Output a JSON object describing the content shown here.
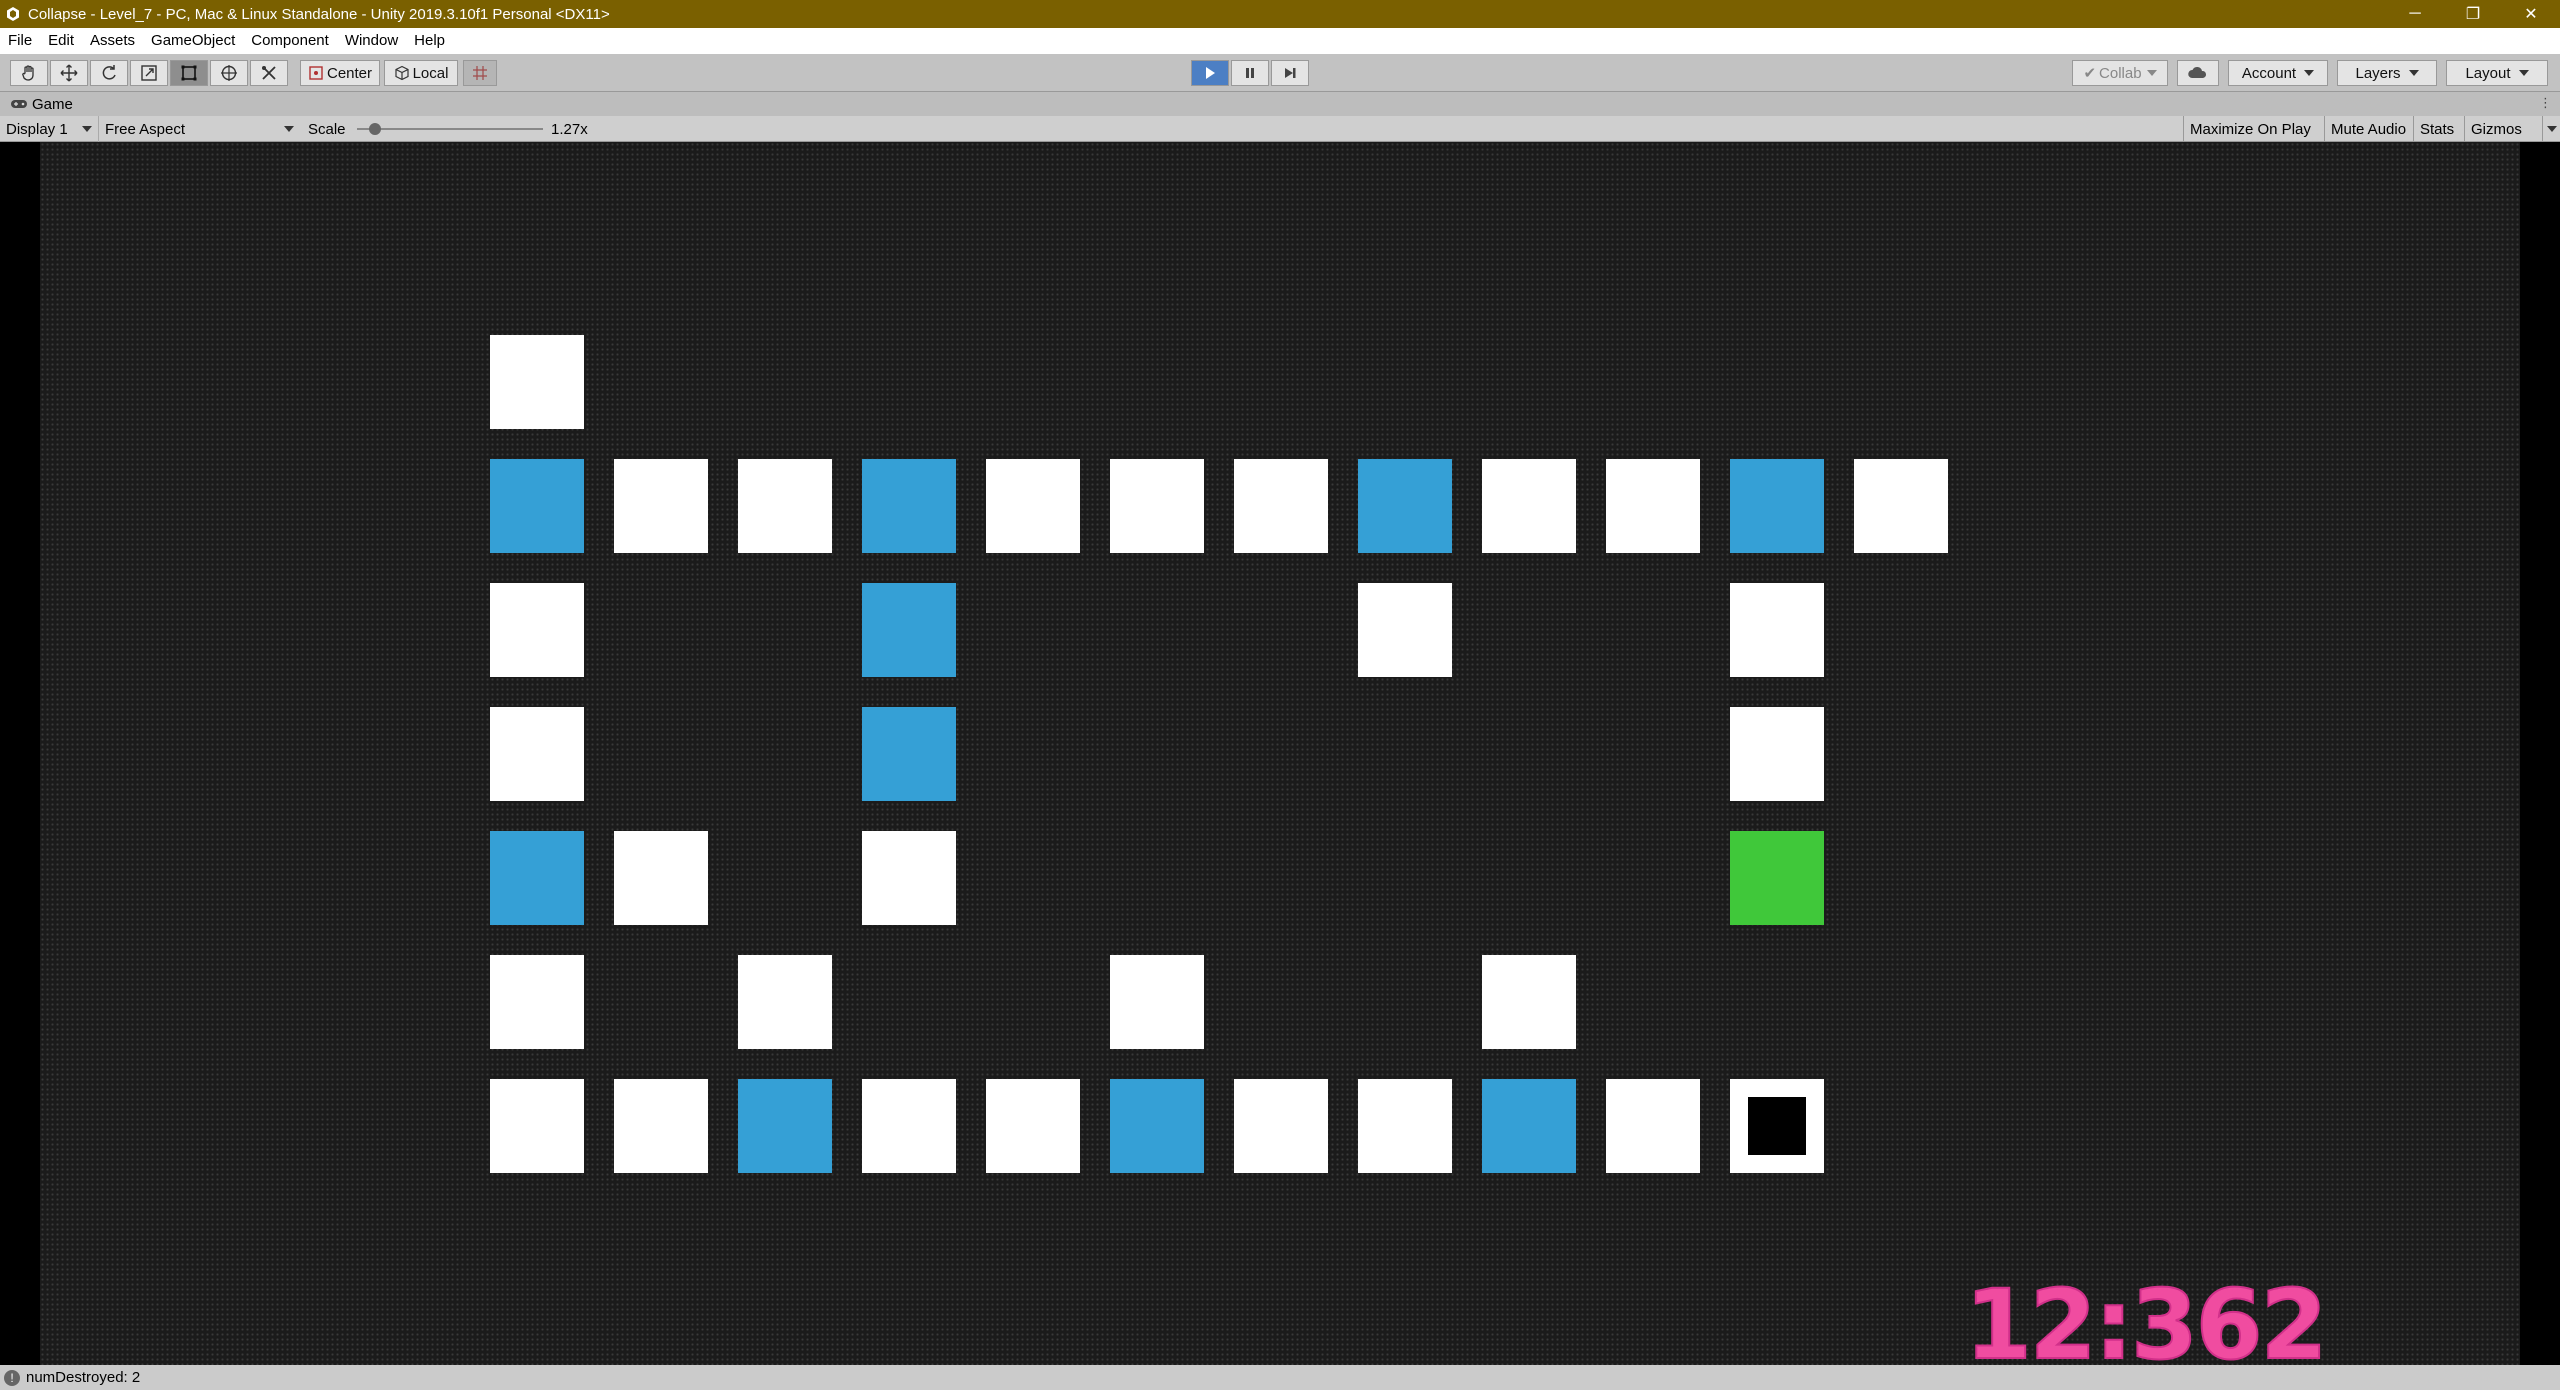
{
  "window": {
    "title": "Collapse - Level_7 - PC, Mac & Linux Standalone - Unity 2019.3.10f1 Personal <DX11>",
    "controls": {
      "minimize": "─",
      "restore": "❐",
      "close": "✕"
    }
  },
  "menu": [
    "File",
    "Edit",
    "Assets",
    "GameObject",
    "Component",
    "Window",
    "Help"
  ],
  "toolbar": {
    "transform_tools": [
      "hand-icon",
      "move-icon",
      "rotate-icon",
      "scale-icon",
      "rect-icon",
      "transform-icon",
      "custom-tool-icon"
    ],
    "active_tool": "rect-icon",
    "pivot_mode": "Center",
    "pivot_rotation": "Local",
    "playing": true,
    "collab": "Collab",
    "account": "Account",
    "layers": "Layers",
    "layout": "Layout"
  },
  "game_panel": {
    "tab": "Game",
    "display": "Display 1",
    "aspect": "Free Aspect",
    "scale_label": "Scale",
    "scale_value": "1.27x",
    "scale_fraction": 0.07,
    "maximize_on_play": "Maximize On Play",
    "mute_audio": "Mute Audio",
    "stats": "Stats",
    "gizmos": "Gizmos"
  },
  "game": {
    "colors": {
      "white": "#ffffff",
      "blue": "#35a0d6",
      "green": "#40c83a",
      "timer": "#f04ca0"
    },
    "grid": [
      [
        "W",
        "-",
        "-",
        "-",
        "-",
        "-",
        "-",
        "-",
        "-",
        "-",
        "-",
        "-"
      ],
      [
        "B",
        "W",
        "W",
        "B",
        "W",
        "W",
        "W",
        "B",
        "W",
        "W",
        "B",
        "W"
      ],
      [
        "W",
        "-",
        "-",
        "B",
        "-",
        "-",
        "-",
        "W",
        "-",
        "-",
        "W",
        "-"
      ],
      [
        "W",
        "-",
        "-",
        "B",
        "-",
        "-",
        "-",
        "-",
        "-",
        "-",
        "W",
        "-"
      ],
      [
        "B",
        "W",
        "-",
        "W",
        "-",
        "-",
        "-",
        "-",
        "-",
        "-",
        "G",
        "-"
      ],
      [
        "W",
        "-",
        "W",
        "-",
        "-",
        "W",
        "-",
        "-",
        "W",
        "-",
        "-",
        "-"
      ],
      [
        "W",
        "W",
        "B",
        "W",
        "W",
        "B",
        "W",
        "W",
        "B",
        "W",
        "P",
        "-"
      ]
    ],
    "timer": "12:362"
  },
  "status": {
    "message": "numDestroyed: 2"
  }
}
